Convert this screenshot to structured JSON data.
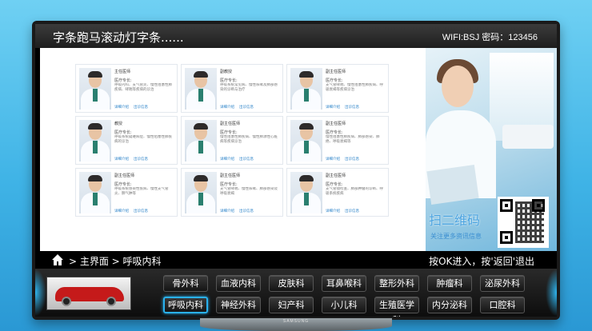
{
  "topbar": {
    "marquee": "字条跑马滚动灯字条......",
    "wifi": "WIFI:BSJ 密码：123456"
  },
  "doctors": [
    {
      "title": "主任医师",
      "spec": "医疗专长:",
      "desc": "呼吸内科、支气管炎、慢性阻塞性肺疾病、哮喘等疾病的诊治",
      "links": [
        "详细介绍",
        "出诊信息"
      ]
    },
    {
      "title": "副教授",
      "spec": "医疗专长:",
      "desc": "呼吸系统常见病、慢性咳嗽及肺部感染的诊断与治疗",
      "links": [
        "详细介绍",
        "出诊信息"
      ]
    },
    {
      "title": "副主任医师",
      "spec": "医疗专长:",
      "desc": "支气管哮喘、慢性阻塞性肺疾病、呼吸衰竭等疾病诊治",
      "links": [
        "详细介绍",
        "出诊信息"
      ]
    },
    {
      "title": "教授",
      "spec": "医疗专长:",
      "desc": "呼吸系统疑难病症、慢性阻塞性肺疾病的诊治",
      "links": [
        "详细介绍",
        "出诊信息"
      ]
    },
    {
      "title": "副主任医师",
      "spec": "医疗专长:",
      "desc": "慢性阻塞性肺疾病、慢性肺源性心脏病等疾病诊治",
      "links": [
        "详细介绍",
        "出诊信息"
      ]
    },
    {
      "title": "副主任医师",
      "spec": "医疗专长:",
      "desc": "慢性阻塞性肺疾病、肺部感染、肺癌、呼吸衰竭等",
      "links": [
        "详细介绍",
        "出诊信息"
      ]
    },
    {
      "title": "副主任医师",
      "spec": "医疗专长:",
      "desc": "呼吸系统感染性疾病、慢性支气管炎、肺气肿等",
      "links": [
        "详细介绍",
        "出诊信息"
      ]
    },
    {
      "title": "副主任医师",
      "spec": "医疗专长:",
      "desc": "支气管哮喘、慢性咳嗽、肺部感染及呼吸衰竭",
      "links": [
        "详细介绍",
        "出诊信息"
      ]
    },
    {
      "title": "副主任医师",
      "spec": "医疗专长:",
      "desc": "支气管镜检查、肺部肿瘤的诊断、呼吸系统疾病",
      "links": [
        "详细介绍",
        "出诊信息"
      ]
    }
  ],
  "ad": {
    "scan_text": "扫二维码",
    "follow_text": "关注更多资讯信息"
  },
  "nav": {
    "breadcrumb": "> 主界面 > 呼吸内科",
    "hint": "按OK进入，按'返回'退出"
  },
  "departments_row1": [
    "骨外科",
    "血液内科",
    "皮肤科",
    "耳鼻喉科",
    "整形外科",
    "肿瘤科",
    "泌尿外科"
  ],
  "departments_row2": [
    "呼吸内科",
    "神经外科",
    "妇产科",
    "小儿科",
    "生殖医学科",
    "内分泌科",
    "口腔科"
  ],
  "selected_department": "呼吸内科",
  "brand": "SAMSUNG",
  "colors": {
    "accent": "#2ab1ee",
    "link": "#2c83c9",
    "background": "#3fb3e6"
  }
}
